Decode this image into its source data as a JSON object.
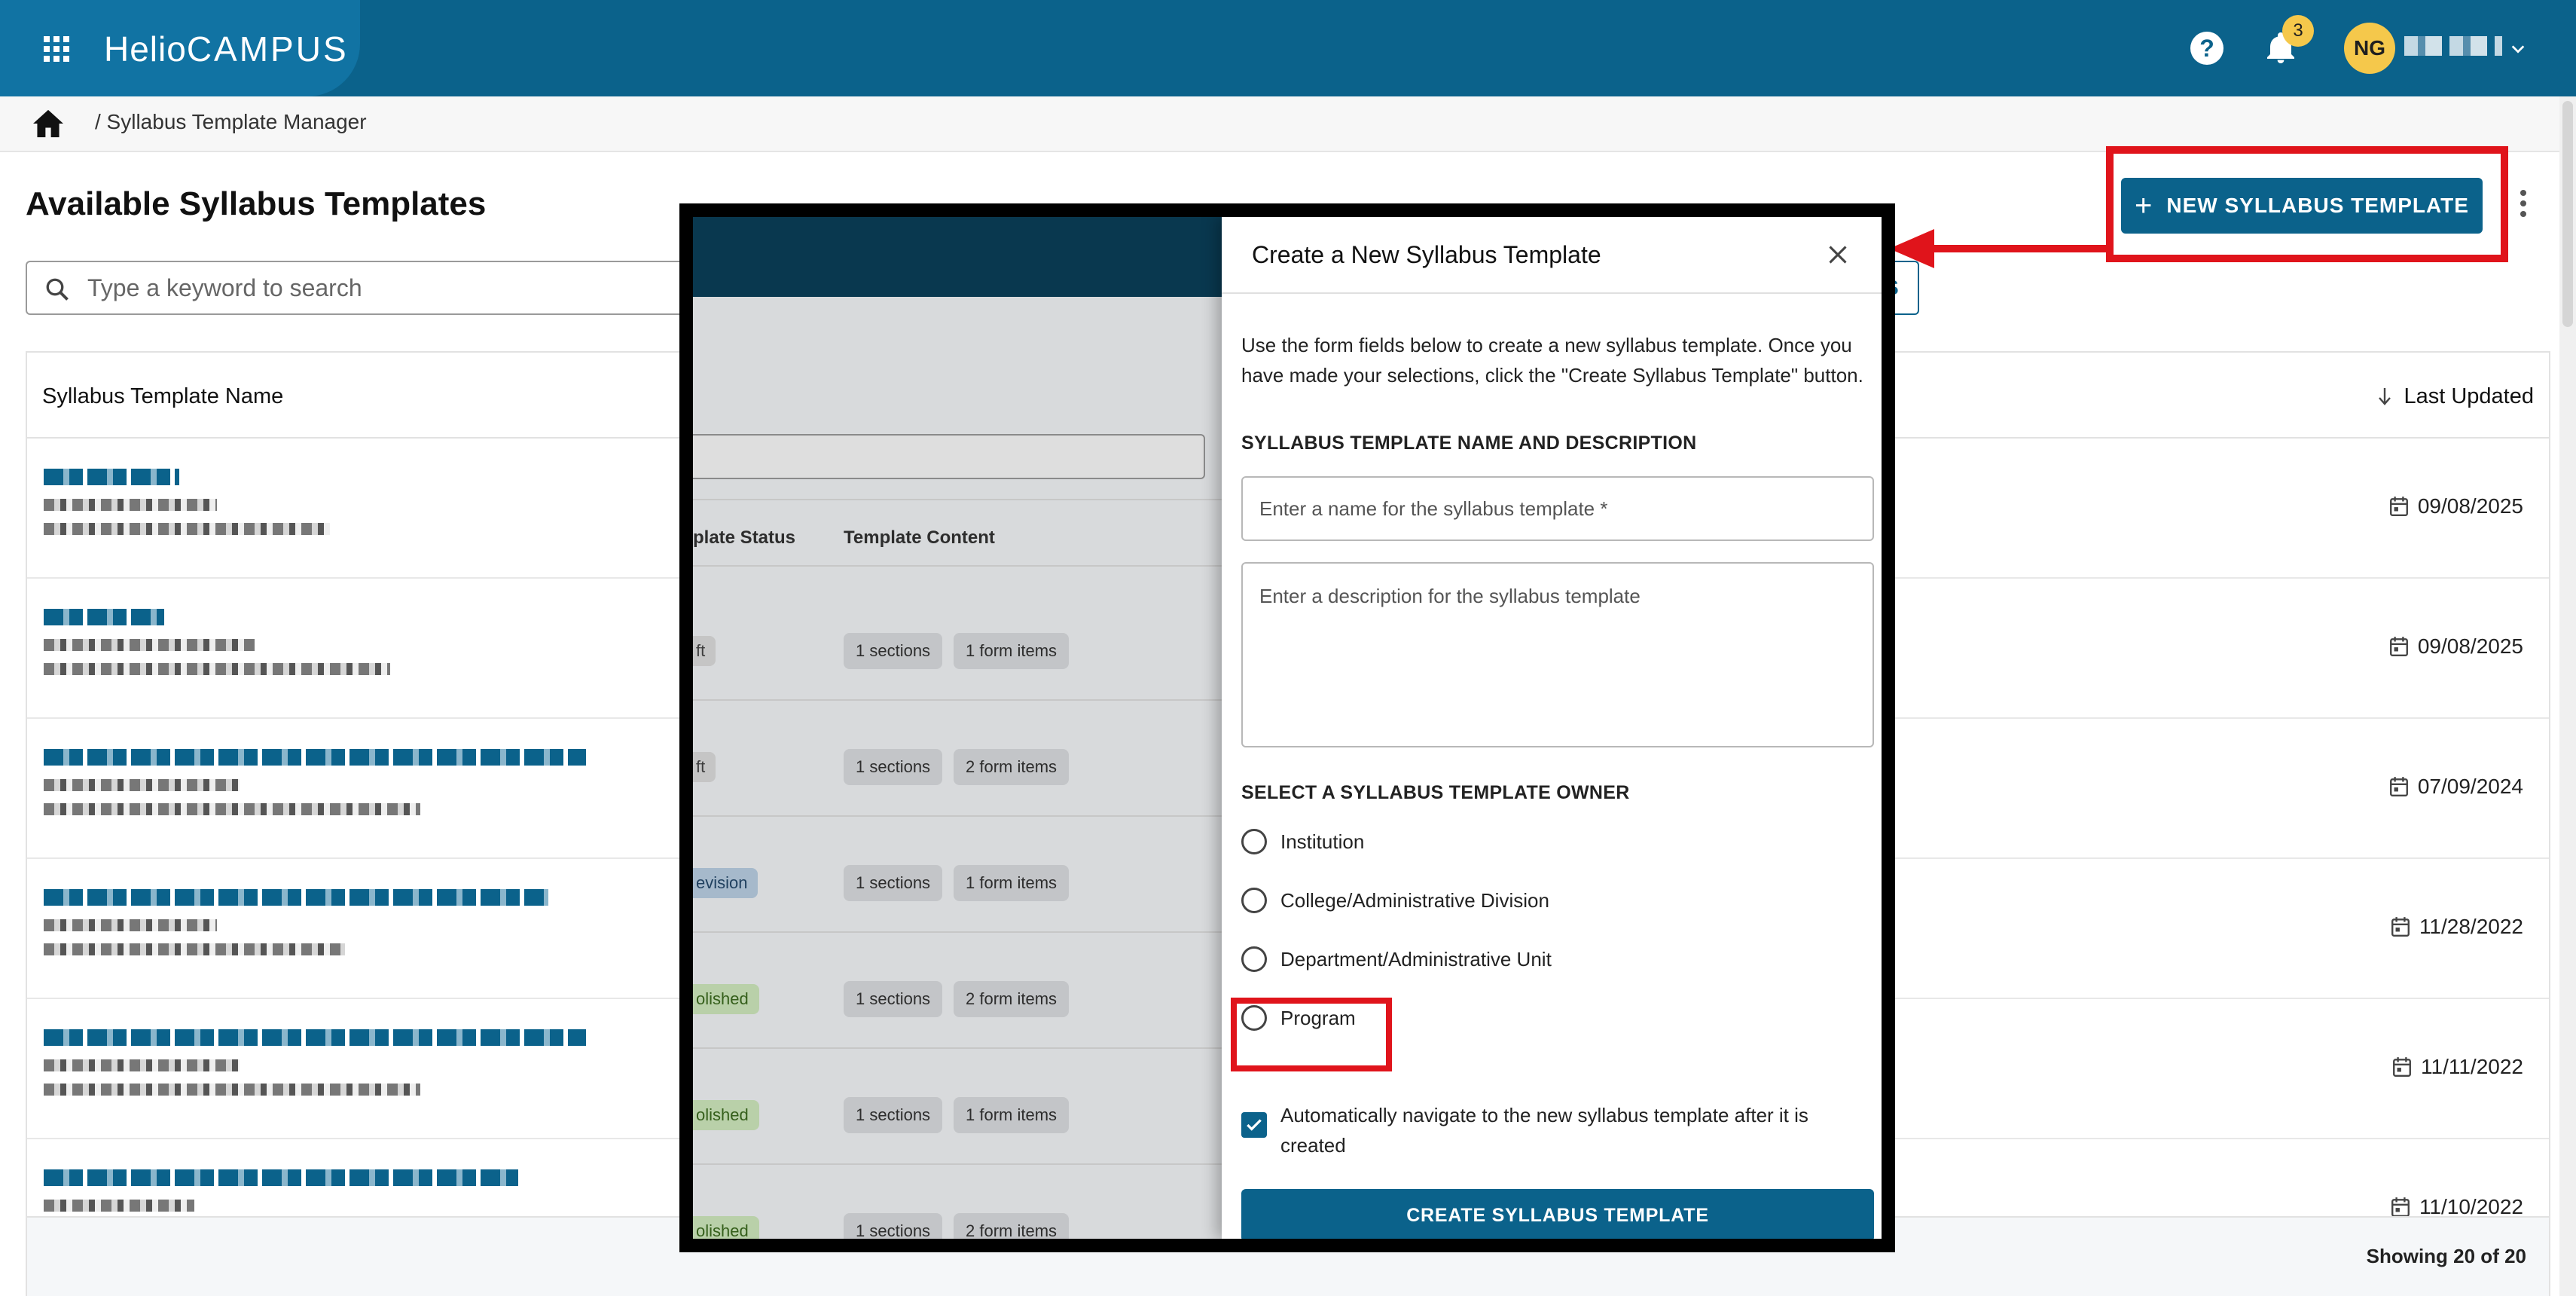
{
  "app": {
    "logo_a": "Helio",
    "logo_b": "CAMPUS",
    "help_glyph": "?",
    "notification_count": "3",
    "user_initials": "NG"
  },
  "breadcrumb": {
    "current": "/ Syllabus Template Manager"
  },
  "page": {
    "title": "Available Syllabus Templates",
    "new_button_label": "NEW SYLLABUS TEMPLATE",
    "new_button_icon": "+",
    "search_placeholder": "Type a keyword to search",
    "filters_edge": "S"
  },
  "table": {
    "col_name": "Syllabus Template Name",
    "col_updated": "Last Updated",
    "rows": [
      {
        "last_updated": "09/08/2025"
      },
      {
        "last_updated": "09/08/2025"
      },
      {
        "last_updated": "07/09/2024"
      },
      {
        "last_updated": "11/28/2022"
      },
      {
        "last_updated": "11/11/2022"
      },
      {
        "last_updated": "11/10/2022"
      }
    ],
    "footer": "Showing 20 of 20"
  },
  "inset_background": {
    "col_status": "plate Status",
    "col_content": "Template Content",
    "rows": [
      {
        "status": "ft",
        "sections": "1 sections",
        "items": "1 form items"
      },
      {
        "status": "ft",
        "sections": "1 sections",
        "items": "2 form items"
      },
      {
        "status": "evision",
        "sections": "1 sections",
        "items": "1 form items"
      },
      {
        "status": "olished",
        "sections": "1 sections",
        "items": "2 form items"
      },
      {
        "status": "olished",
        "sections": "1 sections",
        "items": "1 form items"
      },
      {
        "status": "olished",
        "sections": "1 sections",
        "items": "2 form items"
      }
    ]
  },
  "dialog": {
    "title": "Create a New Syllabus Template",
    "description": "Use the form fields below to create a new syllabus template. Once you have made your selections, click the \"Create Syllabus Template\" button.",
    "name_section_label": "SYLLABUS TEMPLATE NAME AND DESCRIPTION",
    "name_placeholder": "Enter a name for the syllabus template *",
    "description_placeholder": "Enter a description for the syllabus template",
    "owner_section_label": "SELECT A SYLLABUS TEMPLATE OWNER",
    "owner_options": [
      "Institution",
      "College/Administrative Division",
      "Department/Administrative Unit",
      "Program"
    ],
    "auto_navigate_label": "Automatically navigate to the new syllabus template after it is created",
    "auto_navigate_checked": true,
    "create_button_label": "CREATE SYLLABUS TEMPLATE"
  },
  "colors": {
    "brand": "#0b628b",
    "highlight": "#e0141b",
    "badge": "#f5c84b"
  }
}
